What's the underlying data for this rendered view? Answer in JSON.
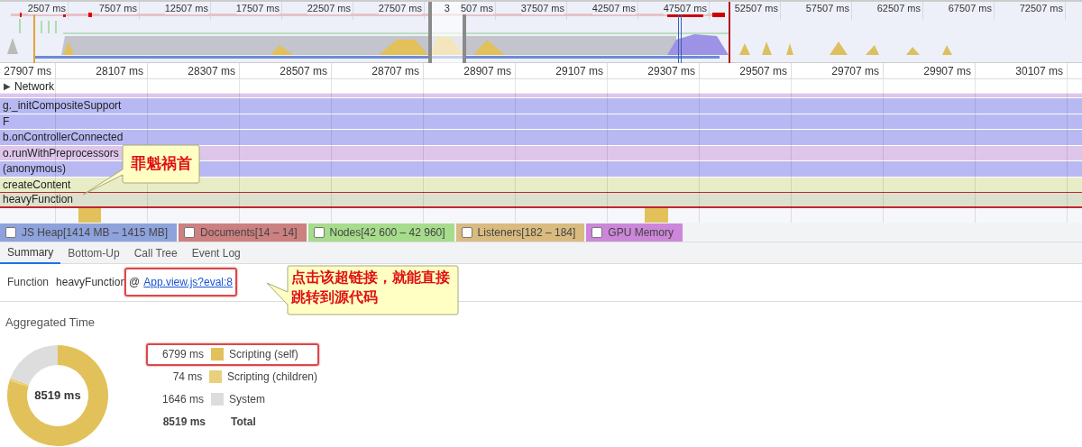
{
  "overview": {
    "covered_tick_head": "3",
    "ticks": [
      "2507 ms",
      "7507 ms",
      "12507 ms",
      "17507 ms",
      "22507 ms",
      "27507 ms",
      "507 ms",
      "37507 ms",
      "42507 ms",
      "47507 ms",
      "52507 ms",
      "57507 ms",
      "62507 ms",
      "67507 ms",
      "72507 ms"
    ]
  },
  "ruler": {
    "ticks": [
      "27907 ms",
      "28107 ms",
      "28307 ms",
      "28507 ms",
      "28707 ms",
      "28907 ms",
      "29107 ms",
      "29307 ms",
      "29507 ms",
      "29707 ms",
      "29907 ms",
      "30107 ms"
    ]
  },
  "network": {
    "arrow": "▶",
    "label": "Network",
    "expanded": false
  },
  "flame": {
    "rows": [
      {
        "label": "g._initCompositeSupport",
        "color": "#b8b9f3",
        "selected": false
      },
      {
        "label": "F",
        "color": "#b8b9f3",
        "selected": false
      },
      {
        "label": "b.onControllerConnected",
        "color": "#b8b9f3",
        "selected": false
      },
      {
        "label": "o.runWithPreprocessors",
        "color": "#dec6eb",
        "selected": false
      },
      {
        "label": "(anonymous)",
        "color": "#b8b9f3",
        "selected": false
      },
      {
        "label": "createContent",
        "color": "#e8edc8",
        "selected": false
      },
      {
        "label": "heavyFunction",
        "color": "#dce1cd",
        "selected": true
      }
    ]
  },
  "callouts": [
    {
      "text": "罪魁祸首"
    },
    {
      "text": "点击该超链接，就能直接跳转到源代码"
    }
  ],
  "counters": [
    {
      "label": "JS Heap[1414 MB – 1415 MB]",
      "color": "#8ea2dc",
      "checked": false
    },
    {
      "label": "Documents[14 – 14]",
      "color": "#cc8080",
      "checked": false
    },
    {
      "label": "Nodes[42 600 – 42 960]",
      "color": "#a6dc8c",
      "checked": false
    },
    {
      "label": "Listeners[182 – 184]",
      "color": "#d9bb80",
      "checked": false
    },
    {
      "label": "GPU Memory",
      "color": "#cc86da",
      "checked": false
    }
  ],
  "tabs": [
    {
      "label": "Summary",
      "selected": true
    },
    {
      "label": "Bottom-Up",
      "selected": false
    },
    {
      "label": "Call Tree",
      "selected": false
    },
    {
      "label": "Event Log",
      "selected": false
    }
  ],
  "summary": {
    "field_label": "Function",
    "function_name": "heavyFunction",
    "at": "@",
    "link": "App.view.js?eval:8",
    "aggregated_title": "Aggregated Time",
    "center_label": "8519 ms",
    "chart_data": {
      "type": "donut",
      "categories": [
        "Scripting (self)",
        "Scripting (children)",
        "System"
      ],
      "series": [
        {
          "values": [
            79.81,
            0.87,
            19.32
          ]
        }
      ]
    },
    "legend": [
      {
        "value": "6799 ms",
        "color": "#e2c15a",
        "highlighted": true
      },
      {
        "value": "74 ms",
        "color": "#e9cf7e",
        "highlighted": false
      },
      {
        "value": "1646 ms",
        "color": "#dddddd",
        "highlighted": false
      }
    ],
    "total": {
      "value": "8519 ms",
      "label": "Total"
    }
  }
}
